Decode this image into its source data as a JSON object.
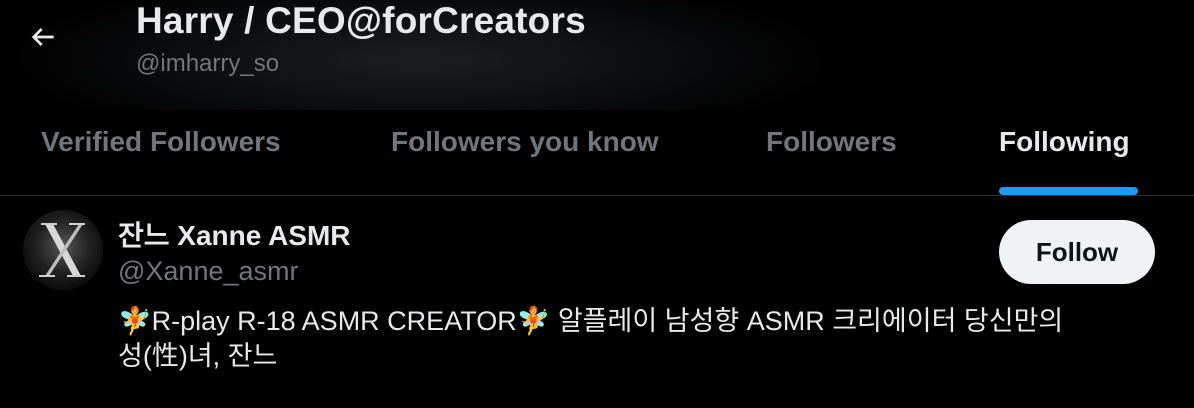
{
  "header": {
    "title": "Harry / CEO@forCreators",
    "handle": "@imharry_so",
    "back_icon": "arrow-left-icon"
  },
  "tabs": [
    {
      "label": "Verified Followers",
      "active": false
    },
    {
      "label": "Followers you know",
      "active": false
    },
    {
      "label": "Followers",
      "active": false
    },
    {
      "label": "Following",
      "active": true
    }
  ],
  "users": [
    {
      "name": "잔느 Xanne ASMR",
      "handle": "@Xanne_asmr",
      "bio_line1": "🧚R-play R-18 ASMR CREATOR🧚 알플레이 남성향 ASMR 크리에이터 당신만의",
      "bio_line2": "성(性)녀, 잔느",
      "follow_label": "Follow",
      "avatar_icon": "x-logo-avatar"
    }
  ],
  "colors": {
    "background": "#000000",
    "primary_text": "#e7e9ea",
    "secondary_text": "#71767b",
    "accent": "#1d9bf0",
    "follow_button_bg": "#eff3f4"
  }
}
